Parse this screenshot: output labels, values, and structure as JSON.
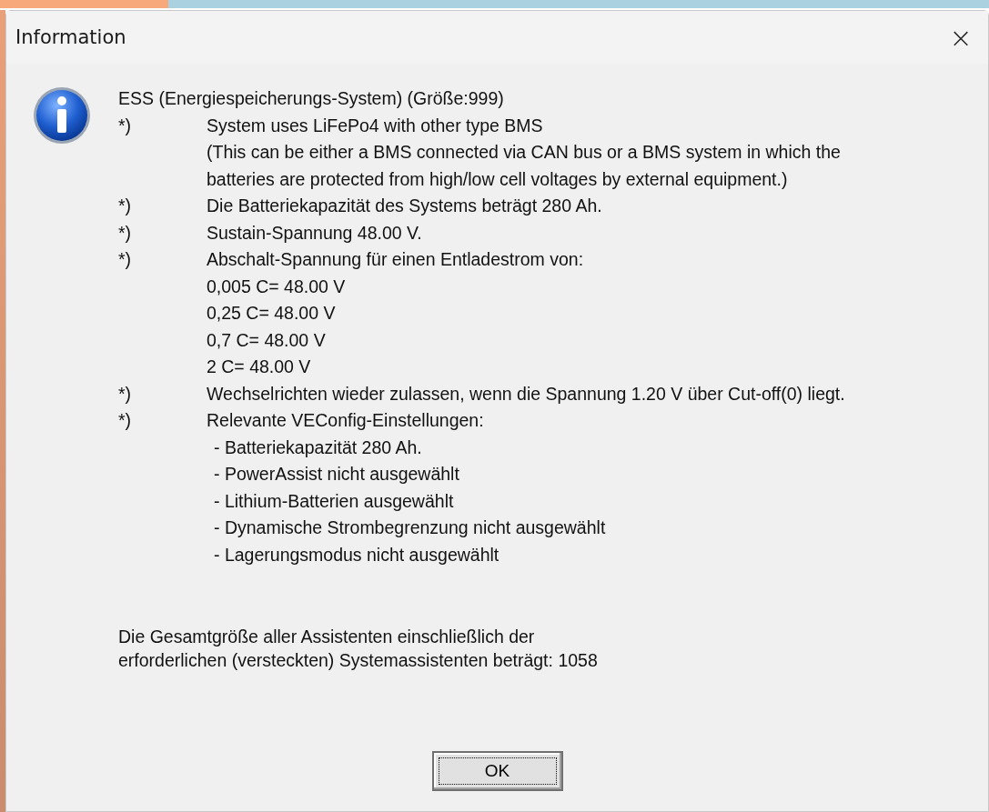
{
  "window": {
    "title": "Information",
    "close": "×"
  },
  "message": {
    "heading": "ESS (Energiespeicherungs-System) (Größe:999)",
    "items": [
      {
        "marker": "*)",
        "lines": [
          "System uses LiFePo4 with other type BMS",
          "(This can be either a BMS connected via CAN bus or a BMS system in which the",
          "batteries are protected from high/low cell voltages by external equipment.)"
        ]
      },
      {
        "marker": "*)",
        "lines": [
          "Die Batteriekapazität des Systems beträgt 280 Ah."
        ]
      },
      {
        "marker": "*)",
        "lines": [
          "Sustain-Spannung 48.00 V."
        ]
      },
      {
        "marker": "*)",
        "lines": [
          "Abschalt-Spannung für einen Entladestrom von:",
          "0,005 C= 48.00 V",
          "0,25 C= 48.00 V",
          "0,7 C= 48.00 V",
          "2 C= 48.00 V"
        ]
      },
      {
        "marker": "*)",
        "lines": [
          "Wechselrichten wieder zulassen, wenn die Spannung 1.20 V über Cut-off(0) liegt."
        ]
      },
      {
        "marker": "*)",
        "lines": [
          "Relevante VEConfig-Einstellungen:"
        ],
        "settings": [
          "- Batteriekapazität 280 Ah.",
          "- PowerAssist nicht ausgewählt",
          "- Lithium-Batterien ausgewählt",
          "- Dynamische Strombegrenzung nicht ausgewählt",
          "- Lagerungsmodus nicht ausgewählt"
        ]
      }
    ],
    "summary": [
      "Die Gesamtgröße aller Assistenten einschließlich der",
      "erforderlichen (versteckten) Systemassistenten beträgt: 1058"
    ]
  },
  "buttons": [
    {
      "label": "OK",
      "focused": true
    }
  ]
}
